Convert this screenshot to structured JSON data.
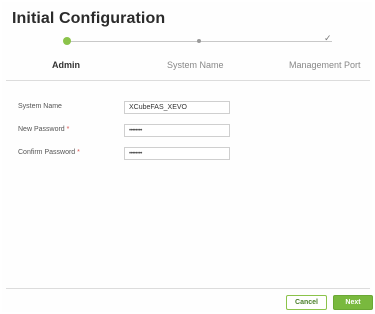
{
  "dialog": {
    "title": "Initial Configuration"
  },
  "wizard": {
    "steps": [
      {
        "label": "Admin",
        "state": "active"
      },
      {
        "label": "System Name",
        "state": "pending"
      },
      {
        "label": "Management Port",
        "state": "pending"
      }
    ]
  },
  "form": {
    "system_name": {
      "label": "System Name",
      "value": "XCubeFAS_XEVO"
    },
    "new_password": {
      "label": "New Password",
      "required_mark": "*",
      "value": "••••••••"
    },
    "confirm_password": {
      "label": "Confirm Password",
      "required_mark": "*",
      "value": "••••••••"
    }
  },
  "buttons": {
    "cancel": "Cancel",
    "next": "Next"
  },
  "colors": {
    "accent": "#79b93e",
    "required": "#d9534f"
  }
}
